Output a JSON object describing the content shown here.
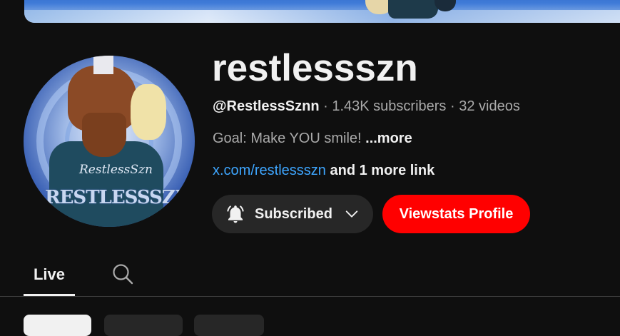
{
  "channel": {
    "name": "restlessszn",
    "handle": "@RestlessSznn",
    "separator1": " · ",
    "subscribers": "1.43K subscribers",
    "separator2": " · ",
    "videos": "32 videos",
    "description": "Goal: Make YOU smile! ",
    "description_more": "...more",
    "link": "x.com/restlessszn",
    "more_links": " and 1 more link"
  },
  "avatar": {
    "shirt_text": "RestlessSzn",
    "watermark": "RESTLESSSZN"
  },
  "actions": {
    "subscribed_label": "Subscribed",
    "subscribed_icon": "bell-icon",
    "dropdown_icon": "chevron-down-icon",
    "viewstats_label": "Viewstats Profile"
  },
  "tabs": {
    "items": [
      {
        "label": "Live",
        "selected": true
      }
    ],
    "search_icon": "search-icon"
  },
  "colors": {
    "background": "#0f0f0f",
    "accent_red": "#ff0000",
    "link_blue": "#3ea6ff",
    "secondary_text": "#aaaaaa",
    "button_gray": "#272727"
  }
}
